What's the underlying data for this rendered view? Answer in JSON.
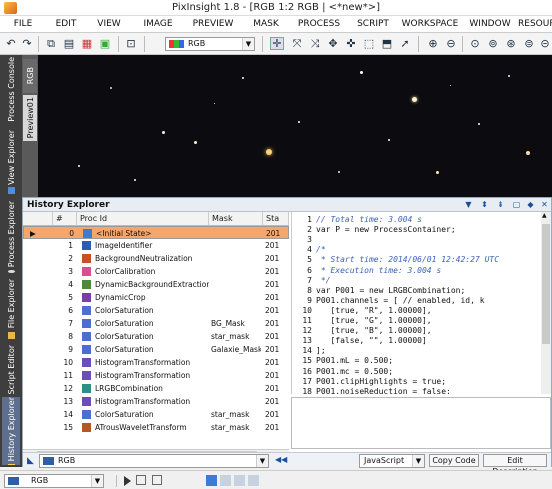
{
  "window": {
    "title": "PixInsight 1.8 - [RGB 1:2 RGB | <*new*>]"
  },
  "menu": [
    "FILE",
    "EDIT",
    "VIEW",
    "IMAGE",
    "PREVIEW",
    "MASK",
    "PROCESS",
    "SCRIPT",
    "WORKSPACE",
    "WINDOW",
    "RESOURCES"
  ],
  "toolbar": {
    "view_select": "RGB"
  },
  "left_tabs": [
    "Process Console",
    "View Explorer",
    "Process Explorer",
    "File Explorer",
    "Script Editor",
    "History Explorer"
  ],
  "view_tabs": [
    "RGB",
    "Preview01"
  ],
  "history": {
    "title": "History Explorer",
    "columns": [
      "#",
      "Proc Id",
      "Mask",
      "Sta"
    ],
    "rows": [
      {
        "n": "0",
        "proc": "<Initial State>",
        "mask": "",
        "sta": "201"
      },
      {
        "n": "1",
        "proc": "ImageIdentifier",
        "mask": "",
        "sta": "201"
      },
      {
        "n": "2",
        "proc": "BackgroundNeutralization",
        "mask": "",
        "sta": "201"
      },
      {
        "n": "3",
        "proc": "ColorCalibration",
        "mask": "",
        "sta": "201"
      },
      {
        "n": "4",
        "proc": "DynamicBackgroundExtraction",
        "mask": "",
        "sta": "201"
      },
      {
        "n": "5",
        "proc": "DynamicCrop",
        "mask": "",
        "sta": "201"
      },
      {
        "n": "6",
        "proc": "ColorSaturation",
        "mask": "",
        "sta": "201"
      },
      {
        "n": "7",
        "proc": "ColorSaturation",
        "mask": "BG_Mask",
        "sta": "201"
      },
      {
        "n": "8",
        "proc": "ColorSaturation",
        "mask": "star_mask",
        "sta": "201"
      },
      {
        "n": "9",
        "proc": "ColorSaturation",
        "mask": "Galaxie_Mask",
        "sta": "201"
      },
      {
        "n": "10",
        "proc": "HistogramTransformation",
        "mask": "",
        "sta": "201"
      },
      {
        "n": "11",
        "proc": "HistogramTransformation",
        "mask": "",
        "sta": "201"
      },
      {
        "n": "12",
        "proc": "LRGBCombination",
        "mask": "",
        "sta": "201"
      },
      {
        "n": "13",
        "proc": "HistogramTransformation",
        "mask": "",
        "sta": "201"
      },
      {
        "n": "14",
        "proc": "ColorSaturation",
        "mask": "star_mask",
        "sta": "201"
      },
      {
        "n": "15",
        "proc": "ATrousWaveletTransform",
        "mask": "star_mask",
        "sta": "201"
      }
    ],
    "footer_view": "RGB",
    "language": "JavaScript",
    "copy_code": "Copy Code",
    "edit_description": "Edit Description"
  },
  "code_lines": [
    {
      "n": "1",
      "text": "// Total time: 3.004 s",
      "cls": "cm"
    },
    {
      "n": "2",
      "text": "var P = new ProcessContainer;",
      "cls": ""
    },
    {
      "n": "3",
      "text": "",
      "cls": ""
    },
    {
      "n": "4",
      "text": "/*",
      "cls": "cm"
    },
    {
      "n": "5",
      "text": " * Start time: 2014/06/01 12:42:27 UTC",
      "cls": "cm"
    },
    {
      "n": "6",
      "text": " * Execution time: 3.004 s",
      "cls": "cm"
    },
    {
      "n": "7",
      "text": " */",
      "cls": "cm"
    },
    {
      "n": "8",
      "text": "var P001 = new LRGBCombination;",
      "cls": ""
    },
    {
      "n": "9",
      "text": "P001.channels = [ // enabled, id, k",
      "cls": ""
    },
    {
      "n": "10",
      "text": "   [true, \"R\", 1.00000],",
      "cls": ""
    },
    {
      "n": "11",
      "text": "   [true, \"G\", 1.00000],",
      "cls": ""
    },
    {
      "n": "12",
      "text": "   [true, \"B\", 1.00000],",
      "cls": ""
    },
    {
      "n": "13",
      "text": "   [false, \"\", 1.00000]",
      "cls": ""
    },
    {
      "n": "14",
      "text": "];",
      "cls": ""
    },
    {
      "n": "15",
      "text": "P001.mL = 0.500;",
      "cls": ""
    },
    {
      "n": "16",
      "text": "P001.mc = 0.500;",
      "cls": ""
    },
    {
      "n": "17",
      "text": "P001.clipHighlights = true;",
      "cls": ""
    },
    {
      "n": "18",
      "text": "P001.noiseReduction = false;",
      "cls": ""
    }
  ],
  "statusbar": {
    "view_select": "RGB"
  }
}
